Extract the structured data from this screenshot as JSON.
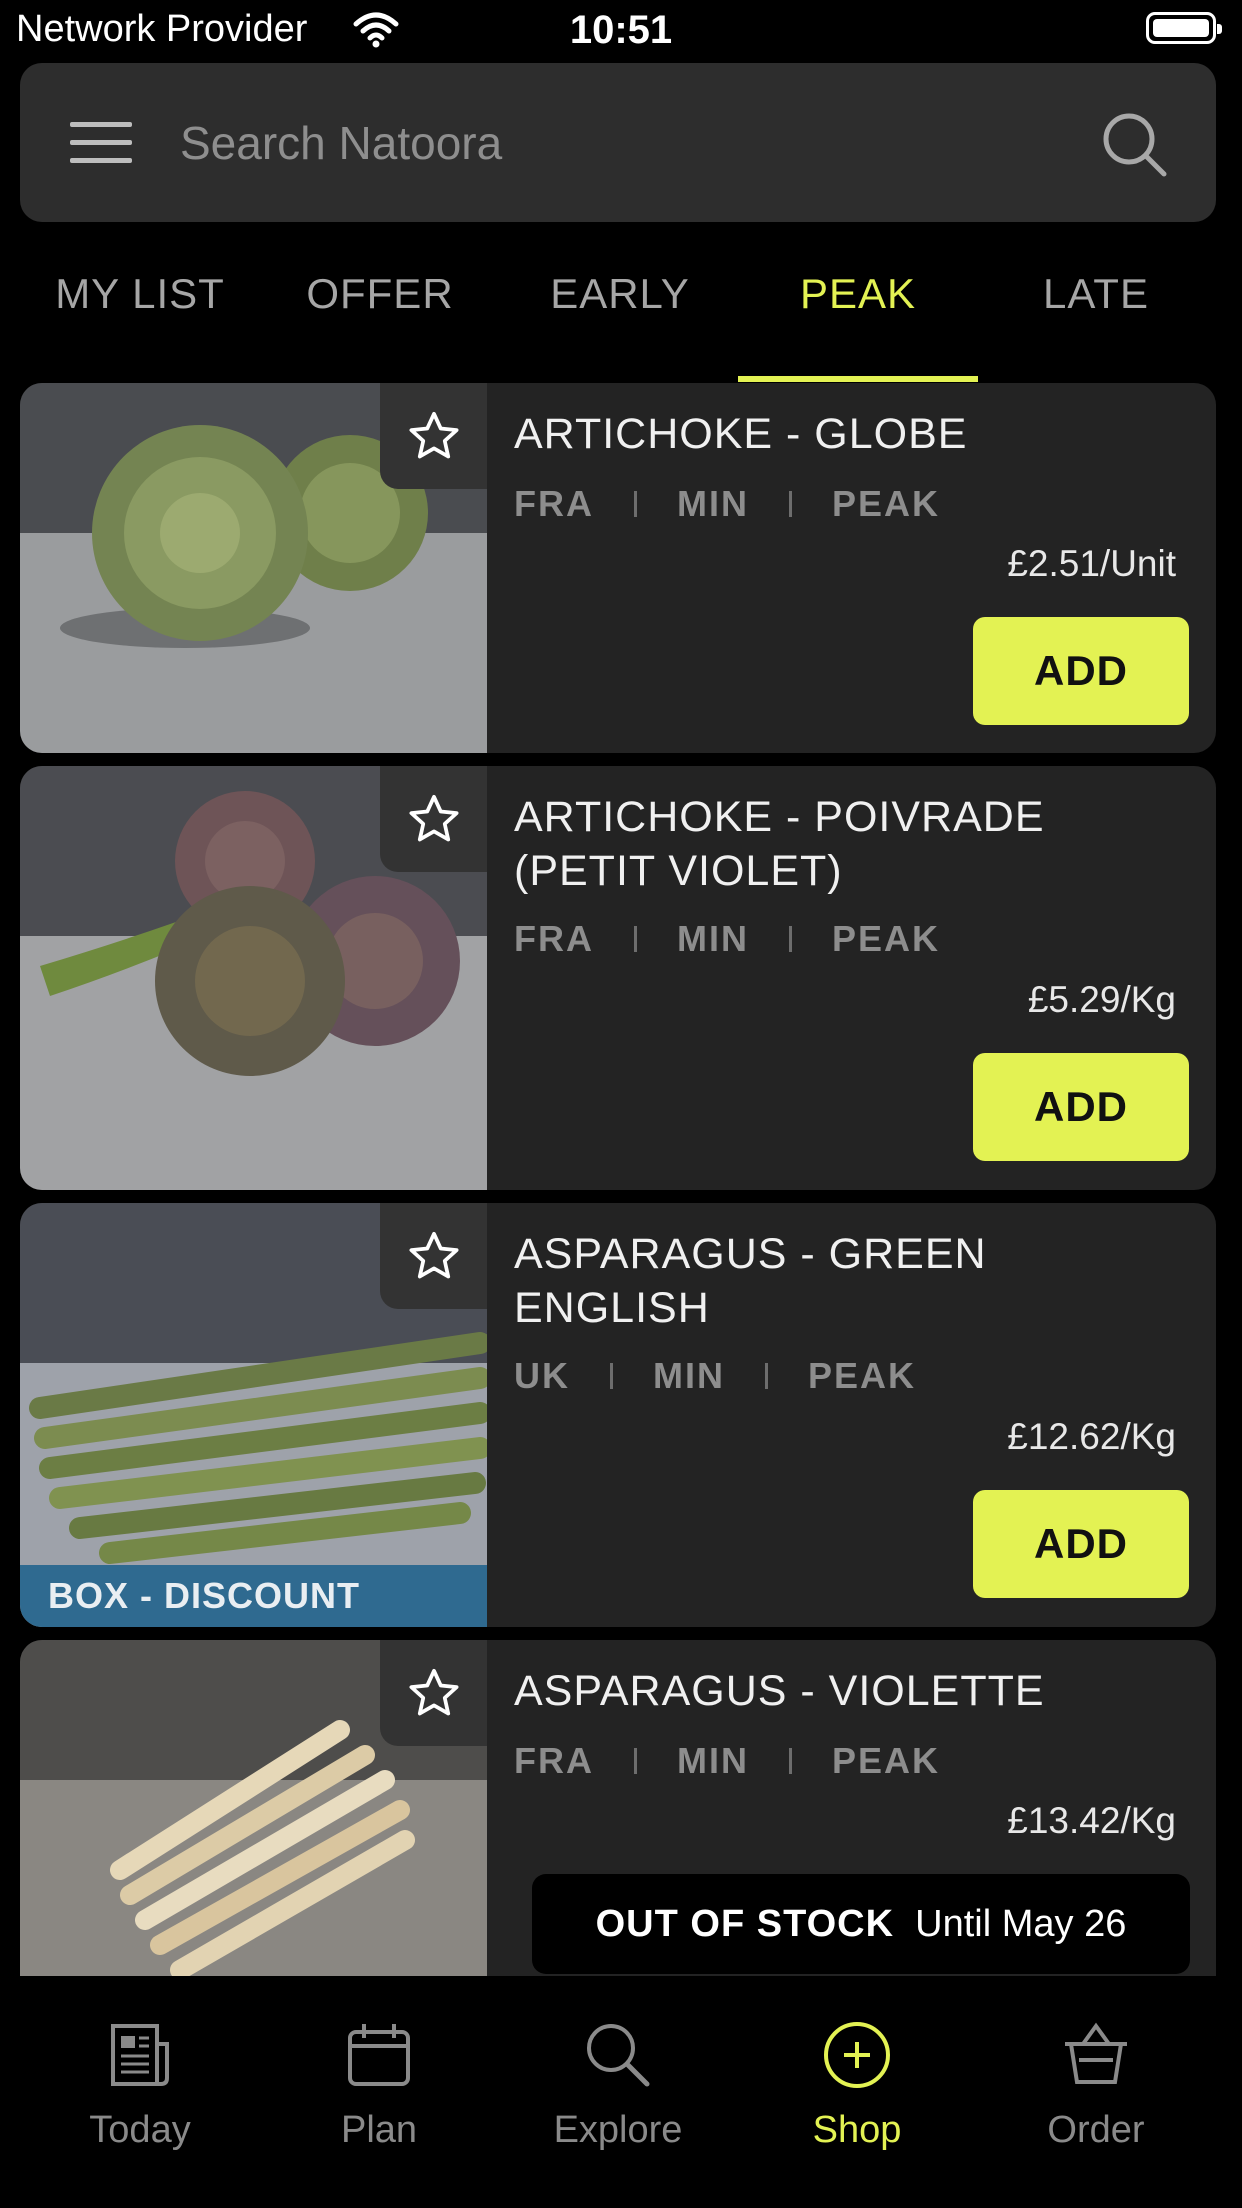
{
  "status_bar": {
    "provider": "Network Provider",
    "time": "10:51"
  },
  "search": {
    "placeholder": "Search Natoora"
  },
  "tabs": [
    {
      "label": "MY LIST",
      "active": false
    },
    {
      "label": "OFFER",
      "active": false
    },
    {
      "label": "EARLY",
      "active": false
    },
    {
      "label": "PEAK",
      "active": true
    },
    {
      "label": "LATE",
      "active": false
    }
  ],
  "products": [
    {
      "title": "ARTICHOKE - GLOBE",
      "origin": "FRA",
      "min": "MIN",
      "season": "PEAK",
      "price": "£2.51/Unit",
      "action": "ADD"
    },
    {
      "title": "ARTICHOKE - POIVRADE (PETIT VIOLET)",
      "origin": "FRA",
      "min": "MIN",
      "season": "PEAK",
      "price": "£5.29/Kg",
      "action": "ADD"
    },
    {
      "title": "ASPARAGUS - GREEN ENGLISH",
      "origin": "UK",
      "min": "MIN",
      "season": "PEAK",
      "price": "£12.62/Kg",
      "action": "ADD",
      "badge": "BOX - DISCOUNT"
    },
    {
      "title": "ASPARAGUS - VIOLETTE",
      "origin": "FRA",
      "min": "MIN",
      "season": "PEAK",
      "price": "£13.42/Kg",
      "stock_status": "OUT OF STOCK",
      "stock_until": "Until May 26"
    }
  ],
  "bottom_nav": [
    {
      "label": "Today",
      "icon": "newspaper-icon",
      "active": false
    },
    {
      "label": "Plan",
      "icon": "calendar-icon",
      "active": false
    },
    {
      "label": "Explore",
      "icon": "search-icon",
      "active": false
    },
    {
      "label": "Shop",
      "icon": "plus-circle-icon",
      "active": true
    },
    {
      "label": "Order",
      "icon": "basket-icon",
      "active": false
    }
  ],
  "colors": {
    "accent": "#e3f253",
    "card": "#232323",
    "badge": "#2f6a90",
    "background": "#000000"
  }
}
